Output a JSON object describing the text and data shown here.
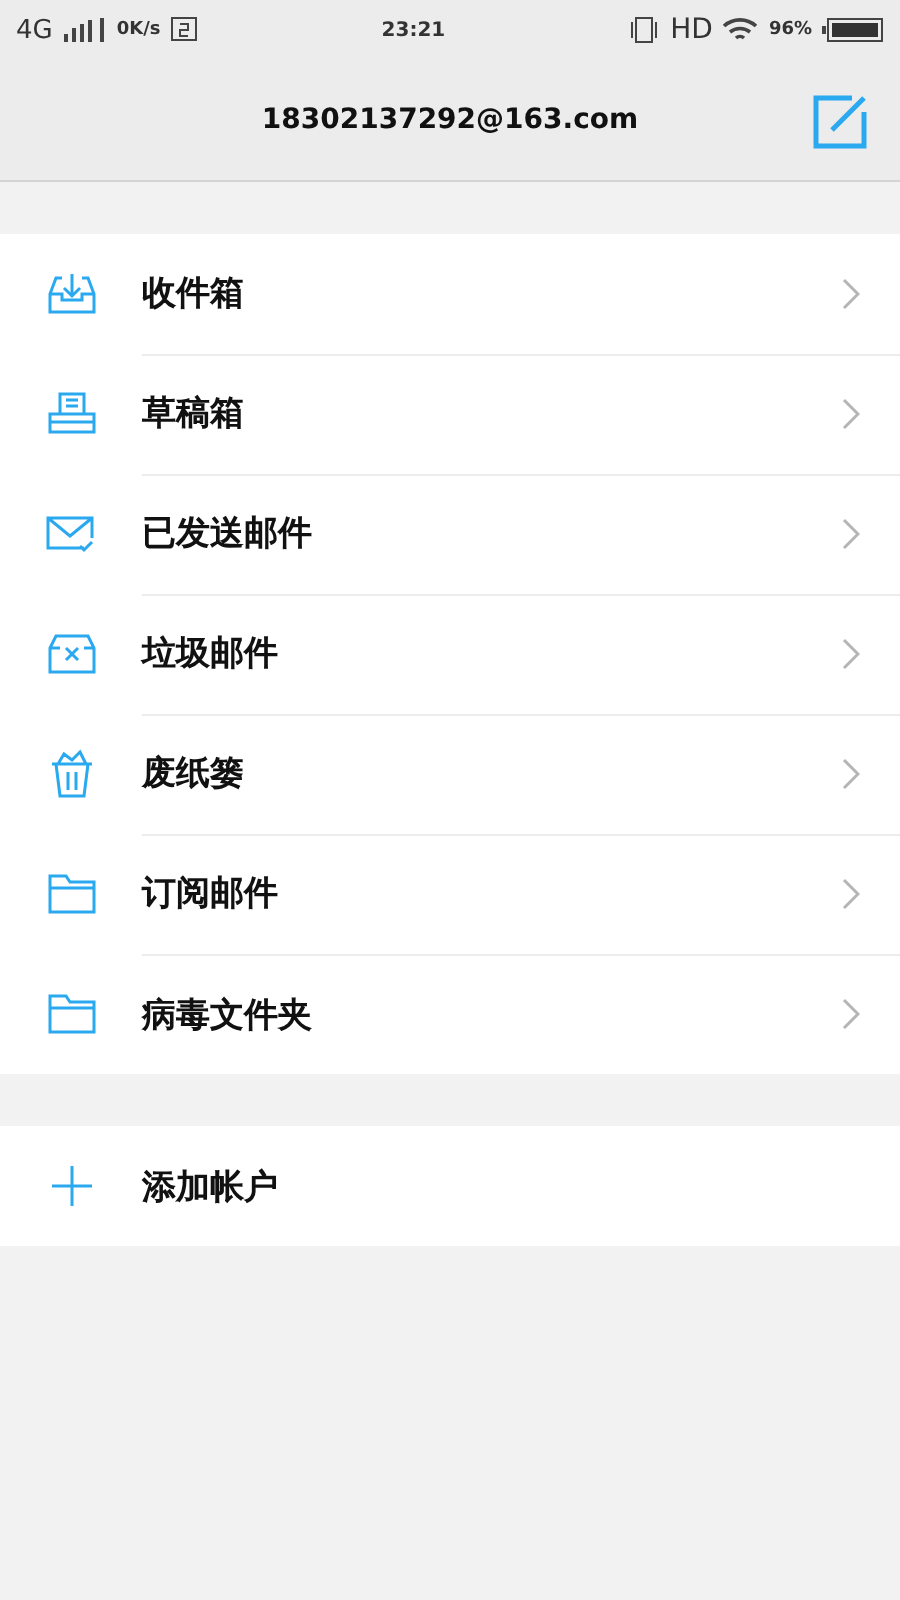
{
  "status_bar": {
    "network": "4G",
    "speed": "0K/s",
    "time": "23:21",
    "hd": "HD",
    "battery": "96%"
  },
  "header": {
    "title": "18302137292@163.com"
  },
  "folders": [
    {
      "kind": "inbox",
      "label": "收件箱"
    },
    {
      "kind": "drafts",
      "label": "草稿箱"
    },
    {
      "kind": "sent",
      "label": "已发送邮件"
    },
    {
      "kind": "junk",
      "label": "垃圾邮件"
    },
    {
      "kind": "trash",
      "label": "废纸篓"
    },
    {
      "kind": "folder",
      "label": "订阅邮件"
    },
    {
      "kind": "folder",
      "label": "病毒文件夹"
    }
  ],
  "add_account": {
    "label": "添加帐户"
  }
}
